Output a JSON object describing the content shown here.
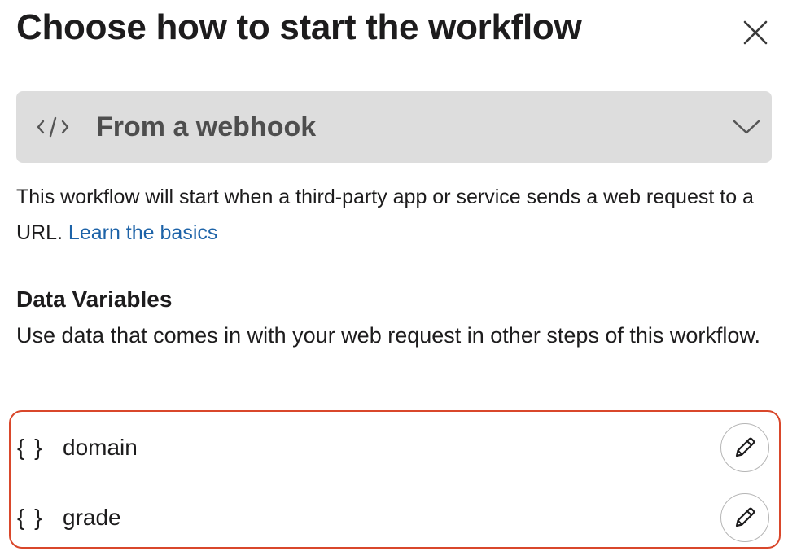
{
  "dialog": {
    "title": "Choose how to start the workflow",
    "close_icon": "close-icon"
  },
  "trigger_select": {
    "icon": "code-icon",
    "selected_label": "From a webhook",
    "chevron_icon": "chevron-down-icon"
  },
  "description": {
    "text": "This workflow will start when a third-party app or service sends a web request to a URL.",
    "link_label": "Learn the basics",
    "link_color": "#1d63a8"
  },
  "data_variables": {
    "title": "Data Variables",
    "description": "Use data that comes in with your web request in other steps of this workflow.",
    "highlight_color": "#d9472b",
    "items": [
      {
        "icon_text": "{ }",
        "name": "domain",
        "edit_icon": "pencil-icon"
      },
      {
        "icon_text": "{ }",
        "name": "grade",
        "edit_icon": "pencil-icon"
      }
    ]
  }
}
